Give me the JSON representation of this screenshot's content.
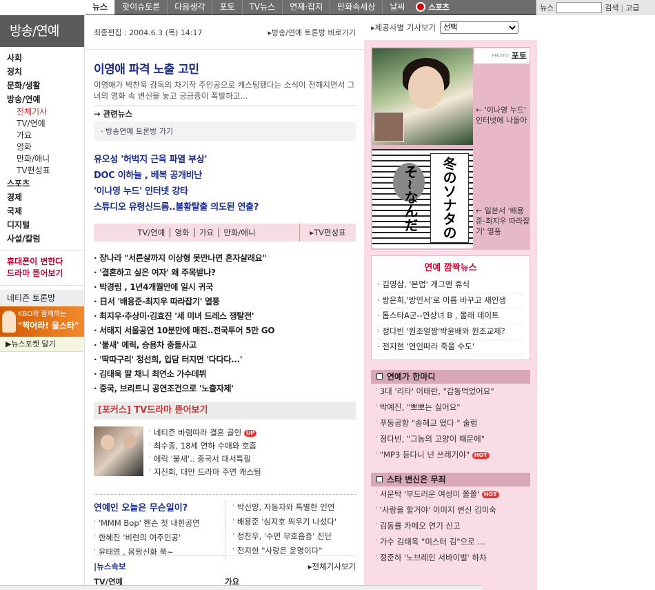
{
  "topnav": {
    "items": [
      "뉴스",
      "핫이슈토론",
      "다음생각",
      "포토",
      "TV뉴스",
      "연재·잡지",
      "만화속세상",
      "날씨"
    ],
    "sports": "스포츠"
  },
  "search": {
    "label": "뉴스",
    "button": "검색",
    "separator": "|",
    "extra": "고급"
  },
  "sidebar": {
    "brand": "방송/연예",
    "menu": [
      {
        "label": "사회",
        "level": 1
      },
      {
        "label": "정치",
        "level": 1
      },
      {
        "label": "문화/생활",
        "level": 1
      },
      {
        "label": "방송/연예",
        "level": 1
      },
      {
        "label": "전체기사",
        "level": 2,
        "selected": true
      },
      {
        "label": "TV/연예",
        "level": 2
      },
      {
        "label": "가요",
        "level": 2
      },
      {
        "label": "영화",
        "level": 2
      },
      {
        "label": "만화/애니",
        "level": 2
      },
      {
        "label": "TV편성표",
        "level": 2
      },
      {
        "label": "스포츠",
        "level": 1
      },
      {
        "label": "경제",
        "level": 1
      },
      {
        "label": "국제",
        "level": 1
      },
      {
        "label": "디지털",
        "level": 1
      },
      {
        "label": "사설/칼럼",
        "level": 1
      }
    ],
    "promo1": "휴대폰이 변한다",
    "promo2": "드라마 뜯어보기",
    "netizen": "네티즌 토론방",
    "kbo_line1": "KBO와 함께하는",
    "kbo_line2": "\"찍어라! 올스타\"",
    "newsforket": "▶뉴스포켓 달기"
  },
  "main": {
    "edited": "최종편집 : 2004.6.3 (목) 14:17",
    "forum_link": "▸방송/연예 토론방 바로가기",
    "headline": {
      "title": "이영애 파격 노출 고민",
      "summary": "이영애가 박찬욱 감독의 차기작 주인공으로 캐스팅됐다는 소식이 전해지면서 그녀의 영화 속 변신을 놓고 궁금증이 폭발하고..."
    },
    "related_title": "→ 관련뉴스",
    "related_link": "· 방송연예 토론방 가기",
    "top_news": [
      "유오성 '허벅지 근육 파열 부상'",
      "DOC 이하늘 , 베복 공개비난",
      "'이나영 누드' 인터넷 강타",
      "스튜디오 유령신드롬..불황탈출 의도된 연출?"
    ],
    "catbar": {
      "cats": "TV/연예 │ 영화 │ 가요 │ 만화/애니",
      "tv": "▸TV편성표"
    },
    "list": [
      "장나라 \"서른살까지 이상형 못만나면 혼자살래요\"",
      "'결혼하고 싶은 여자' 왜 주목받나?",
      "박경림 , 1년4개월만에 일시 귀국",
      "日서 '배용준-최지우 따라잡기' 열풍",
      "최지우·추상미·김효진 '세 미녀 드레스 쟁탈전'",
      "서태지 서울공연 10분만에 매진..전국투어 5만 GO",
      "'불새' 에릭, 승용차 충돌사고",
      "'딱따구리' 정선희, 입담 터지면 '다다다...'",
      "김태욱 딸 채니 최연소 가수데뷔",
      "중국, 브리트니 공연조건으로 '노출자제'"
    ],
    "focus_title": "[포커스] TV드라마 뜯어보기",
    "focus_items": [
      "네티즌 바램따라 결혼 골인",
      "최수종, 18세 연하 수애와 호흡",
      "에릭 '불새'.. 중국서 대서특필",
      "지진희, 대만 드라마 주연 캐스팅"
    ],
    "focus_badge": "UP",
    "today_title": "연예인 오늘은 무슨일이?",
    "today_left": [
      "'MMM Bop' 핸슨 첫 내한공연",
      "한혜진 '비련의 여주인공'",
      "윤태영 , 몸짱신화 쭉~"
    ],
    "today_right": [
      "박신양, 자동차와 특별한 인연",
      "배용준 '심지호 띄우기 나섰다'",
      "정찬우, '수면 무호흡증' 진단",
      "전지현 \"사랑은 운명이다\""
    ],
    "quick_title": "|뉴스속보",
    "quick_more": "▸전체기사보기",
    "quick_col1": "TV/연예",
    "quick_col2": "가요"
  },
  "right": {
    "provider_label": "▸제공사별 기사보기",
    "provider_select": "선택",
    "photo_small": "PHOTO",
    "photo_label": "포토",
    "cap1": "← '이나영 누드' 인터넷에 나돌아",
    "cap2": "← 일본서 '배용준-최지우 따라잡기' 열풍",
    "photo2_text": "冬のソナタのそ~なんだ",
    "gossip_title": "연예 깜짝뉴스",
    "gossip": [
      "김영삼, '본업' 개그맨 휴식",
      "방은희,'방민서'로 이름 바꾸고 새인생",
      "톱스타A군--연상녀 B , 몰래 데이트",
      "정다빈 '원조얼짱'박윤배와 원조교제?",
      "전지현 '연인따라 죽을 수도'"
    ],
    "section1_title": "연예가 한마디",
    "section1": [
      "3대 '리타' 이태란, \"감동먹었어요\"",
      "박예진, \"뽀뽀는 싫어요\"",
      "푸둥공항 \"송혜교 떴다 \" 술렁",
      "정다빈, \"그놈의 고양이 때문에\"",
      "\"MP3 듣다니 넌 쓰레기야\""
    ],
    "section2_title": "스타 변신은 무죄",
    "section2": [
      "서문탁 '부드러운 여성미 쫄쫄'",
      "'사랑을 할거야' 이미지 변신 김미숙",
      "김동률 카메오 연기 신고",
      "가수 김태욱 \"미스터 김\"으로 ...",
      "정준하 '노브레인 서바이벌' 하차"
    ],
    "hot": "HOT"
  }
}
